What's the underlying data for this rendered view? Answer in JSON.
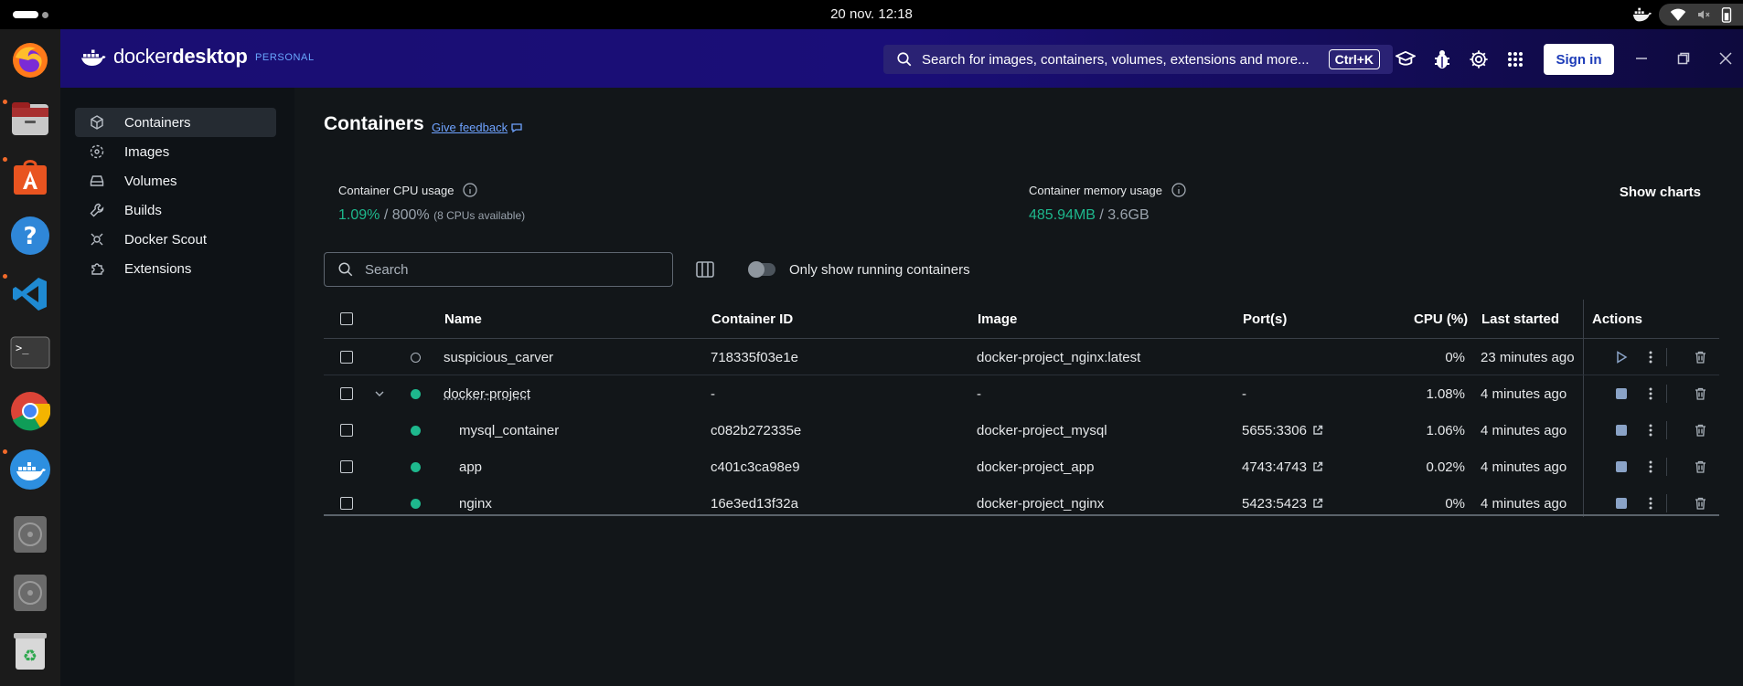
{
  "system": {
    "clock": "20 nov.  12:18"
  },
  "app": {
    "logo_light": "docker",
    "logo_bold": "desktop",
    "plan": "PERSONAL",
    "search_placeholder": "Search for images, containers, volumes, extensions and more...",
    "shortcut": "Ctrl+K",
    "signin_label": "Sign in"
  },
  "sidebar": {
    "items": [
      {
        "label": "Containers",
        "icon": "cube-icon",
        "active": true
      },
      {
        "label": "Images",
        "icon": "images-icon"
      },
      {
        "label": "Volumes",
        "icon": "volumes-icon"
      },
      {
        "label": "Builds",
        "icon": "wrench-icon"
      },
      {
        "label": "Docker Scout",
        "icon": "scout-icon"
      },
      {
        "label": "Extensions",
        "icon": "puzzle-icon"
      }
    ]
  },
  "main": {
    "title": "Containers",
    "feedback": "Give feedback",
    "cpu": {
      "label": "Container CPU usage",
      "value": "1.09%",
      "sep": " / ",
      "total": "800%",
      "note": "(8 CPUs available)"
    },
    "memory": {
      "label": "Container memory usage",
      "value": "485.94MB",
      "sep": " / ",
      "total": "3.6GB"
    },
    "show_charts": "Show charts",
    "search_placeholder": "Search",
    "running_toggle_label": "Only show running containers"
  },
  "table": {
    "headers": {
      "name": "Name",
      "container_id": "Container ID",
      "image": "Image",
      "ports": "Port(s)",
      "cpu": "CPU (%)",
      "last_started": "Last started",
      "actions": "Actions"
    },
    "rows": [
      {
        "name": "suspicious_carver",
        "id": "718335f03e1e",
        "image": "docker-project_nginx:latest",
        "ports": "",
        "cpu": "0%",
        "last_started": "23 minutes ago",
        "status": "stopped",
        "group": false,
        "child": false
      },
      {
        "name": "docker-project",
        "id": "-",
        "image": "-",
        "ports": "-",
        "cpu": "1.08%",
        "last_started": "4 minutes ago",
        "status": "running",
        "group": true,
        "child": false
      },
      {
        "name": "mysql_container",
        "id": "c082b272335e",
        "image": "docker-project_mysql",
        "ports": "5655:3306",
        "cpu": "1.06%",
        "last_started": "4 minutes ago",
        "status": "running",
        "group": false,
        "child": true
      },
      {
        "name": "app",
        "id": "c401c3ca98e9",
        "image": "docker-project_app",
        "ports": "4743:4743",
        "cpu": "0.02%",
        "last_started": "4 minutes ago",
        "status": "running",
        "group": false,
        "child": true
      },
      {
        "name": "nginx",
        "id": "16e3ed13f32a",
        "image": "docker-project_nginx",
        "ports": "5423:5423",
        "cpu": "0%",
        "last_started": "4 minutes ago",
        "status": "running",
        "group": false,
        "child": true
      }
    ]
  }
}
